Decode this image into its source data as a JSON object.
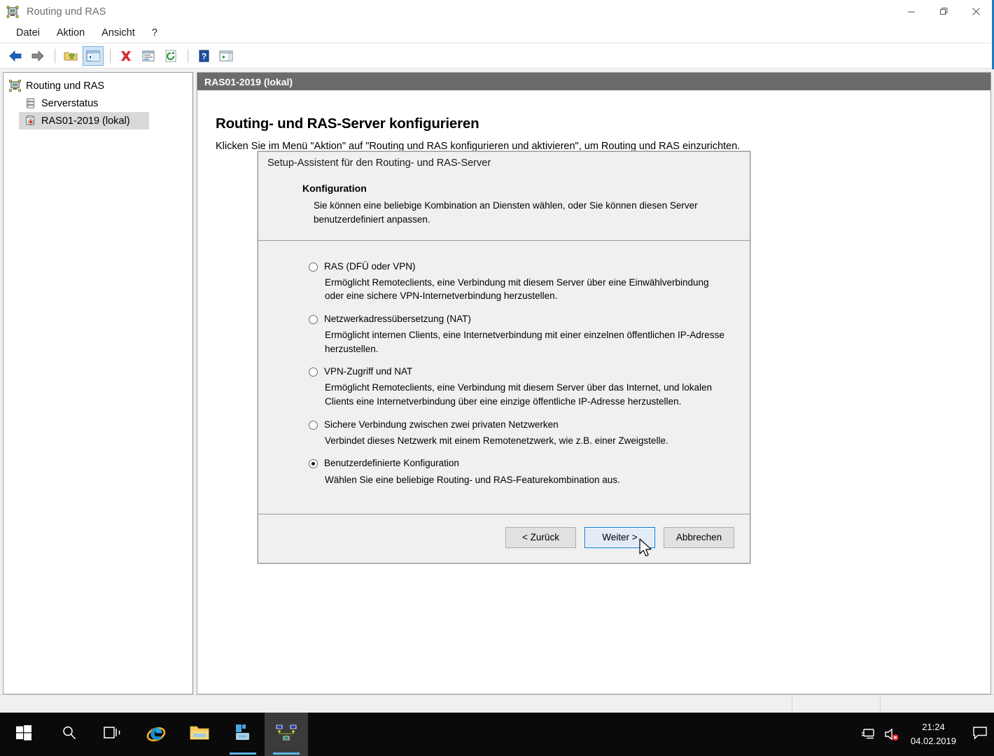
{
  "window": {
    "title": "Routing und RAS",
    "icon": "routing-ras-icon",
    "minimize_label": "—",
    "restore_label": "❐",
    "close_label": "✕"
  },
  "menubar": {
    "items": [
      {
        "label": "Datei",
        "name": "menu-datei"
      },
      {
        "label": "Aktion",
        "name": "menu-aktion"
      },
      {
        "label": "Ansicht",
        "name": "menu-ansicht"
      },
      {
        "label": "?",
        "name": "menu-help"
      }
    ]
  },
  "toolbar": {
    "buttons": [
      {
        "name": "back-icon",
        "title": "Zurück"
      },
      {
        "name": "forward-icon",
        "title": "Vorwärts"
      },
      {
        "name": "up-folder-icon",
        "title": "Eine Ebene höher"
      },
      {
        "name": "show-hide-console-tree-icon",
        "title": "Konsolenstruktur anzeigen/ausblenden"
      },
      {
        "name": "delete-icon",
        "title": "Löschen"
      },
      {
        "name": "properties-icon",
        "title": "Eigenschaften"
      },
      {
        "name": "refresh-icon",
        "title": "Aktualisieren"
      },
      {
        "name": "help-icon",
        "title": "Hilfe"
      },
      {
        "name": "show-hide-action-pane-icon",
        "title": "Aktionsbereich anzeigen/ausblenden"
      }
    ]
  },
  "tree": {
    "items": [
      {
        "label": "Routing und RAS",
        "icon": "routing-ras-root-icon",
        "level": 0,
        "selected": false
      },
      {
        "label": "Serverstatus",
        "icon": "server-status-icon",
        "level": 1,
        "selected": false
      },
      {
        "label": "RAS01-2019 (lokal)",
        "icon": "ras-server-icon",
        "level": 1,
        "selected": true
      }
    ]
  },
  "detail": {
    "header": "RAS01-2019 (lokal)",
    "title": "Routing- und RAS-Server konfigurieren",
    "subtitle": "Klicken Sie im Menü \"Aktion\" auf \"Routing und RAS konfigurieren und aktivieren\", um Routing und RAS einzurichten."
  },
  "wizard": {
    "caption": "Setup-Assistent für den Routing- und RAS-Server",
    "heading": "Konfiguration",
    "description": "Sie können eine beliebige Kombination an Diensten wählen, oder Sie können diesen Server benutzerdefiniert anpassen.",
    "options": [
      {
        "name": "option-ras",
        "label": "RAS (DFÜ oder VPN)",
        "description": "Ermöglicht Remoteclients, eine Verbindung mit diesem Server über eine Einwählverbindung oder eine sichere VPN-Internetverbindung herzustellen.",
        "checked": false
      },
      {
        "name": "option-nat",
        "label": "Netzwerkadressübersetzung (NAT)",
        "description": "Ermöglicht internen Clients, eine Internetverbindung mit einer einzelnen öffentlichen IP-Adresse herzustellen.",
        "checked": false
      },
      {
        "name": "option-vpn-and-nat",
        "label": "VPN-Zugriff und NAT",
        "description": "Ermöglicht Remoteclients, eine Verbindung mit diesem Server über das Internet, und lokalen Clients eine Internetverbindung über eine einzige öffentliche IP-Adresse herzustellen.",
        "checked": false
      },
      {
        "name": "option-secure-connection",
        "label": "Sichere Verbindung zwischen zwei privaten Netzwerken",
        "description": "Verbindet dieses Netzwerk mit einem Remotenetzwerk, wie z.B. einer Zweigstelle.",
        "checked": false
      },
      {
        "name": "option-custom",
        "label": "Benutzerdefinierte Konfiguration",
        "description": "Wählen Sie eine beliebige Routing- und RAS-Featurekombination aus.",
        "checked": true
      }
    ],
    "buttons": {
      "back": "< Zurück",
      "next": "Weiter >",
      "cancel": "Abbrechen"
    }
  },
  "taskbar": {
    "items": [
      {
        "name": "start-button",
        "icon": "windows-logo-icon",
        "state": "idle"
      },
      {
        "name": "search-button",
        "icon": "search-icon",
        "state": "idle"
      },
      {
        "name": "task-view-button",
        "icon": "task-view-icon",
        "state": "idle"
      },
      {
        "name": "internet-explorer-button",
        "icon": "internet-explorer-icon",
        "state": "idle"
      },
      {
        "name": "file-explorer-button",
        "icon": "file-explorer-icon",
        "state": "idle"
      },
      {
        "name": "server-manager-button",
        "icon": "server-manager-icon",
        "state": "running"
      },
      {
        "name": "routing-ras-button",
        "icon": "routing-ras-taskbar-icon",
        "state": "active"
      }
    ],
    "tray": {
      "network_icon": "network-icon",
      "volume_icon": "volume-muted-icon",
      "action_center_icon": "action-center-icon",
      "time": "21:24",
      "date": "04.02.2019"
    }
  },
  "colors": {
    "accent": "#0078d7",
    "window_border": "#1f7bbf",
    "detail_header_bg": "#6b6b6b",
    "dialog_bg": "#f0f0f0",
    "taskbar_bg": "#0a0a0a",
    "running_indicator": "#5cb3e8"
  }
}
